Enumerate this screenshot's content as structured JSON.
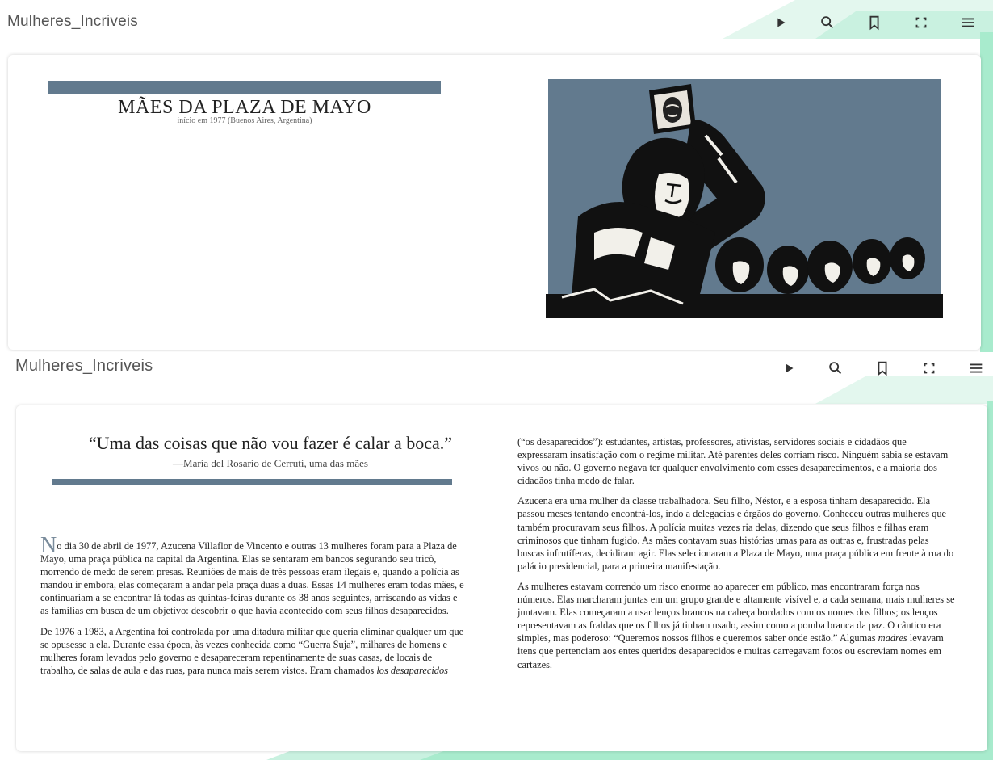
{
  "viewer": {
    "app_title": "Mulheres_Incriveis",
    "toolbar": [
      {
        "icon": "play-icon"
      },
      {
        "icon": "search-icon"
      },
      {
        "icon": "bookmark-icon"
      },
      {
        "icon": "fullscreen-icon"
      },
      {
        "icon": "menu-icon"
      }
    ]
  },
  "colors": {
    "accent": "#627a8e",
    "mint": "#c9f1e0",
    "mint_dark": "#7fe0b7"
  },
  "page1": {
    "title": "MÃES DA PLAZA DE MAYO",
    "subtitle": "início em 1977 (Buenos Aires, Argentina)",
    "illustration": "mothers-with-photo-illustration"
  },
  "page2": {
    "quote": "“Uma das coisas que não vou fazer é calar a boca.”",
    "attribution": "—María del Rosario de Cerruti, uma das mães",
    "left_col": {
      "p1_dropcap": "N",
      "p1": "o dia 30 de abril de 1977, Azucena Villaflor de Vincento e outras 13 mulheres foram para a Plaza de Mayo, uma praça pública na capital da Argentina. Elas se sentaram em bancos segurando seu tricô, morrendo de medo de serem presas. Reuniões de mais de três pessoas eram ilegais e, quando a polícia as mandou ir embora, elas começaram a andar pela praça duas a duas. Essas 14 mulheres eram todas mães, e continuariam a se encontrar lá todas as quintas-feiras durante os 38 anos seguintes, arriscando as vidas e as famílias em busca de um objetivo: descobrir o que havia acontecido com seus filhos desaparecidos.",
      "p2_a": "De 1976 a 1983, a Argentina foi controlada por uma ditadura militar que queria eliminar qualquer um que se opusesse a ela. Durante essa época, às vezes conhecida como “Guerra Suja”, milhares de homens e mulheres foram levados pelo governo e desapareceram repentinamente de suas casas, de locais de trabalho, de salas de aula e das ruas, para nunca mais serem vistos. Eram chamados ",
      "p2_em": "los desaparecidos"
    },
    "right_col": {
      "p1": "(“os desaparecidos”): estudantes, artistas, professores, ativistas, servidores sociais e cidadãos que expressaram insatisfação com o regime militar. Até parentes deles corriam risco. Ninguém sabia se estavam vivos ou não. O governo negava ter qualquer envolvimento com esses desaparecimentos, e a maioria dos cidadãos tinha medo de falar.",
      "p2": "Azucena era uma mulher da classe trabalhadora. Seu filho, Néstor, e a esposa tinham desaparecido. Ela passou meses tentando encontrá-los, indo a delegacias e órgãos do governo. Conheceu outras mulheres que também procuravam seus filhos. A polícia muitas vezes ria delas, dizendo que seus filhos e filhas eram criminosos que tinham fugido. As mães contavam suas histórias umas para as outras e, frustradas pelas buscas infrutíferas, decidiram agir. Elas selecionaram a Plaza de Mayo, uma praça pública em frente à rua do palácio presidencial, para a primeira manifestação.",
      "p3_a": "As mulheres estavam correndo um risco enorme ao aparecer em público, mas encontraram força nos números. Elas marcharam juntas em um grupo grande e altamente visível e, a cada semana, mais mulheres se juntavam. Elas começaram a usar lenços brancos na cabeça bordados com os nomes dos filhos; os lenços representavam as fraldas que os filhos já tinham usado, assim como a pomba branca da paz. O cântico era simples, mas poderoso: “Queremos nossos filhos e queremos saber onde estão.” Algumas ",
      "p3_em": "madres",
      "p3_b": " levavam itens que pertenciam aos entes queridos desaparecidos e muitas carregavam fotos ou escreviam nomes em cartazes."
    }
  }
}
